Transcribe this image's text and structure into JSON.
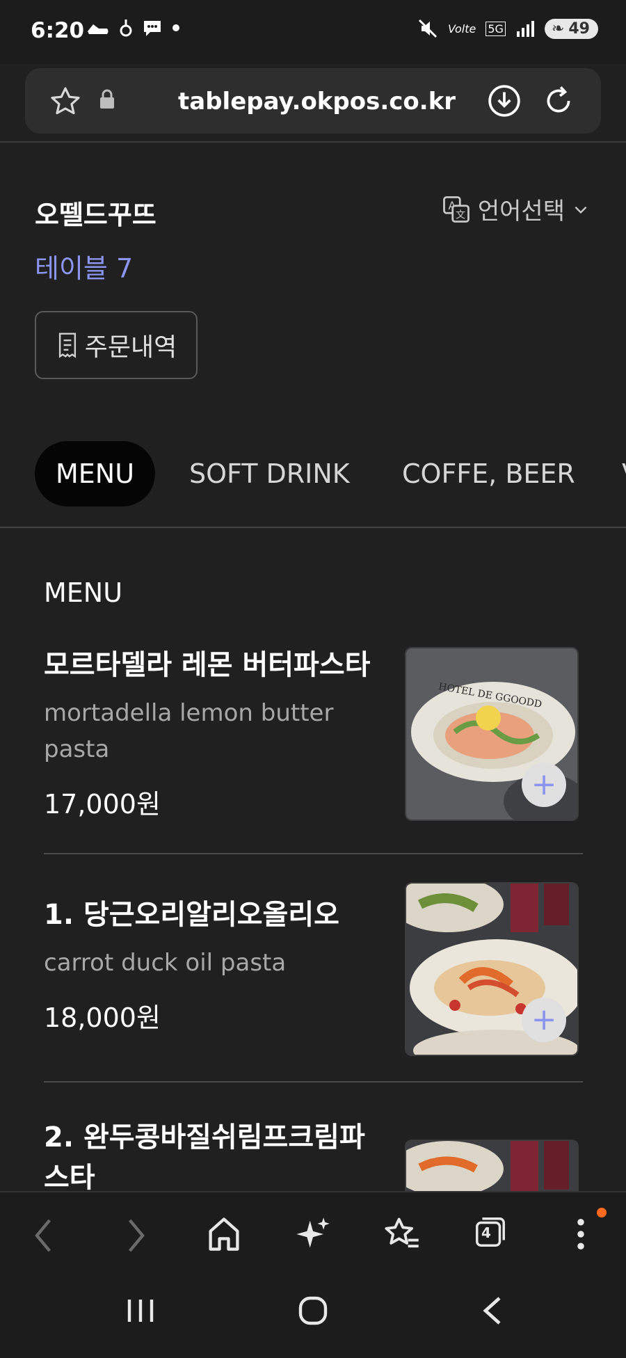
{
  "status_bar": {
    "time": "6:20",
    "battery": "49",
    "network": "5G",
    "volte": "Volte"
  },
  "browser": {
    "url": "tablepay.okpos.co.kr",
    "tab_count": "4"
  },
  "store": {
    "name": "오뗄드꾸뜨",
    "table": "테이블 7",
    "language_label": "언어선택",
    "orders_label": "주문내역"
  },
  "tabs": [
    {
      "label": "MENU",
      "active": true
    },
    {
      "label": "SOFT DRINK",
      "active": false
    },
    {
      "label": "COFFE, BEER",
      "active": false
    }
  ],
  "section_title": "MENU",
  "menu_items": [
    {
      "name": "모르타델라 레몬 버터파스타",
      "en": "mortadella lemon butter pasta",
      "price": "17,000원",
      "image_icon": "pasta-photo"
    },
    {
      "name": "1. 당근오리알리오올리오",
      "en": "carrot duck oil pasta",
      "price": "18,000원",
      "image_icon": "pasta-photo"
    },
    {
      "name": "2. 완두콩바질쉬림프크림파스타",
      "en": "",
      "price": "",
      "image_icon": "pasta-photo"
    }
  ],
  "colors": {
    "accent": "#8b95f0",
    "background": "#202020",
    "active_tab": "#050505",
    "notification": "#ff6a1f"
  }
}
